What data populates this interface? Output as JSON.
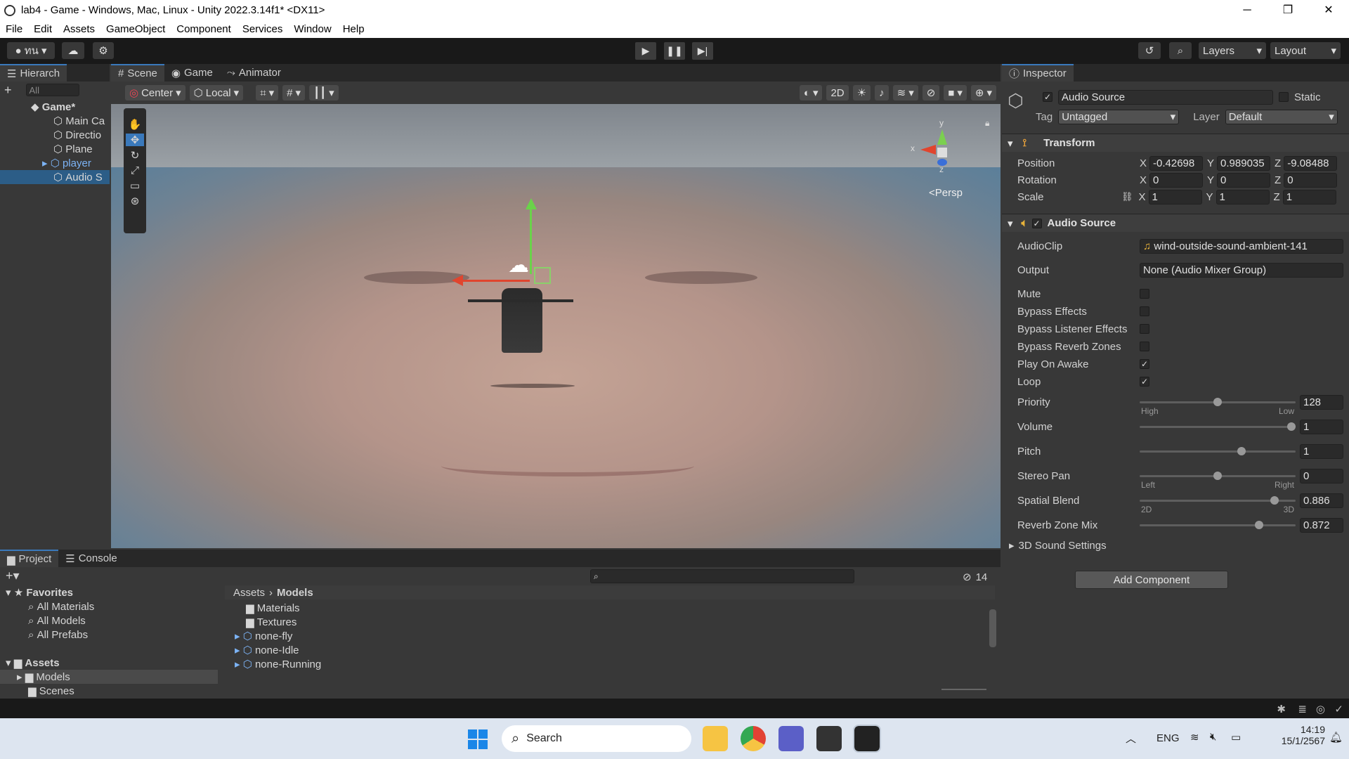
{
  "window": {
    "title": "lab4 - Game - Windows, Mac, Linux - Unity 2022.3.14f1* <DX11>",
    "minimize": "─",
    "restore": "❐",
    "close": "✕"
  },
  "menu": [
    "File",
    "Edit",
    "Assets",
    "GameObject",
    "Component",
    "Services",
    "Window",
    "Help"
  ],
  "toolbar": {
    "account": "ทน",
    "layers": "Layers",
    "layout": "Layout"
  },
  "hierarchy": {
    "tab": "Hierarch",
    "search_placeholder": "All",
    "root": "Game*",
    "items": [
      "Main Ca",
      "Directio",
      "Plane",
      "player",
      "Audio S"
    ]
  },
  "scene": {
    "tabs": [
      "Scene",
      "Game",
      "Animator"
    ],
    "pivot": "Center",
    "space": "Local",
    "mode_2d": "2D",
    "gizmo_y": "y",
    "gizmo_x": "x",
    "gizmo_z": "z",
    "persp": "<Persp"
  },
  "inspector": {
    "tab": "Inspector",
    "object_name": "Audio Source",
    "static": "Static",
    "tag_label": "Tag",
    "tag": "Untagged",
    "layer_label": "Layer",
    "layer": "Default",
    "transform": {
      "title": "Transform",
      "position_label": "Position",
      "rotation_label": "Rotation",
      "scale_label": "Scale",
      "position": {
        "x": "-0.42698",
        "y": "0.989035",
        "z": "-9.08488"
      },
      "rotation": {
        "x": "0",
        "y": "0",
        "z": "0"
      },
      "scale": {
        "x": "1",
        "y": "1",
        "z": "1"
      }
    },
    "audio": {
      "title": "Audio Source",
      "audioclip_label": "AudioClip",
      "audioclip": "wind-outside-sound-ambient-141",
      "output_label": "Output",
      "output": "None (Audio Mixer Group)",
      "toggles": [
        {
          "label": "Mute",
          "checked": false
        },
        {
          "label": "Bypass Effects",
          "checked": false
        },
        {
          "label": "Bypass Listener Effects",
          "checked": false
        },
        {
          "label": "Bypass Reverb Zones",
          "checked": false
        },
        {
          "label": "Play On Awake",
          "checked": true
        },
        {
          "label": "Loop",
          "checked": true
        }
      ],
      "sliders": [
        {
          "label": "Priority",
          "value": "128",
          "level": 0.5,
          "left": "High",
          "right": "Low"
        },
        {
          "label": "Volume",
          "value": "1",
          "level": 1.0,
          "left": "",
          "right": ""
        },
        {
          "label": "Pitch",
          "value": "1",
          "level": 0.66,
          "left": "",
          "right": ""
        },
        {
          "label": "Stereo Pan",
          "value": "0",
          "level": 0.5,
          "left": "Left",
          "right": "Right"
        },
        {
          "label": "Spatial Blend",
          "value": "0.886",
          "level": 0.886,
          "left": "2D",
          "right": "3D"
        },
        {
          "label": "Reverb Zone Mix",
          "value": "0.872",
          "level": 0.78,
          "left": "",
          "right": ""
        }
      ],
      "sound_settings": "3D Sound Settings"
    },
    "add_component": "Add Component"
  },
  "project": {
    "tabs": [
      "Project",
      "Console"
    ],
    "favorites_label": "Favorites",
    "favorites": [
      "All Materials",
      "All Models",
      "All Prefabs"
    ],
    "assets_label": "Assets",
    "asset_folders": [
      "Models",
      "Scenes"
    ],
    "breadcrumb_root": "Assets",
    "breadcrumb_current": "Models",
    "items": [
      {
        "name": "Materials",
        "type": "folder"
      },
      {
        "name": "Textures",
        "type": "folder"
      },
      {
        "name": "none-fly",
        "type": "model"
      },
      {
        "name": "none-Idle",
        "type": "model"
      },
      {
        "name": "none-Running",
        "type": "model"
      }
    ],
    "hidden_count": "14"
  },
  "taskbar": {
    "search": "Search",
    "lang": "ENG",
    "time": "14:19",
    "date": "15/1/2567"
  },
  "colors": {
    "accent": "#3a79bb",
    "selected": "#2c5d87",
    "player": "#7cb3f5"
  }
}
